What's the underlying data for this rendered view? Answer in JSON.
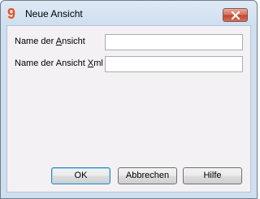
{
  "window": {
    "title": "Neue Ansicht",
    "app_icon_glyph": "9",
    "app_icon_color": "#e8531f"
  },
  "form": {
    "name_label_pre": "Name der ",
    "name_label_accel": "A",
    "name_label_post": "nsicht",
    "name_value": "",
    "xml_label_pre": "Name der Ansicht ",
    "xml_label_accel": "X",
    "xml_label_post": "ml",
    "xml_value": ""
  },
  "buttons": {
    "ok": "OK",
    "cancel": "Abbrechen",
    "help": "Hilfe"
  }
}
